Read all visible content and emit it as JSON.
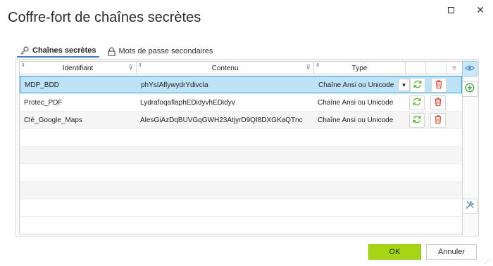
{
  "window": {
    "title": "Coffre-fort de chaînes secrètes",
    "minimize_icon": "minimize-icon",
    "close_icon": "close-icon",
    "close_glyph": "✕"
  },
  "tabs": [
    {
      "label": "Chaînes secrètes",
      "icon": "key-icon",
      "active": true
    },
    {
      "label": "Mots de passe secondaires",
      "icon": "padlock-icon",
      "active": false
    }
  ],
  "grid": {
    "columns": [
      {
        "label": "Identifiant",
        "sortable": true,
        "filterable": true
      },
      {
        "label": "Contenu",
        "sortable": true,
        "filterable": true
      },
      {
        "label": "Type",
        "sortable": true,
        "filterable": false
      }
    ],
    "menu_glyph": "≡",
    "sort_glyph": "⇕",
    "filter_glyph": "⊽",
    "dropdown_glyph": "▼",
    "rows": [
      {
        "identifiant": "MDP_BDD",
        "contenu": "phYsIAflywydrYdivcla",
        "type": "Chaîne Ansi ou Unicode",
        "selected": true
      },
      {
        "identifiant": "Protec_PDF",
        "contenu": "LydrafoqaflaphEDidyvhEDidyv",
        "type": "Chaîne Ansi ou Unicode",
        "selected": false
      },
      {
        "identifiant": "Clé_Google_Maps",
        "contenu": "AlesGiAzDqBUVGqGWH23AtjyrD9QI8DXGKaQTnc",
        "type": "Chaîne Ansi ou Unicode",
        "selected": false
      }
    ]
  },
  "side_tools": [
    "eye-icon",
    "add-icon",
    "tools-icon"
  ],
  "footer": {
    "ok_label": "OK",
    "cancel_label": "Annuler"
  },
  "colors": {
    "selection_bg": "#bee3f6",
    "selection_border": "#2f9be0",
    "ok_button": "#a6d514",
    "refresh_green": "#5ab82f",
    "delete_red": "#d84a3a"
  }
}
